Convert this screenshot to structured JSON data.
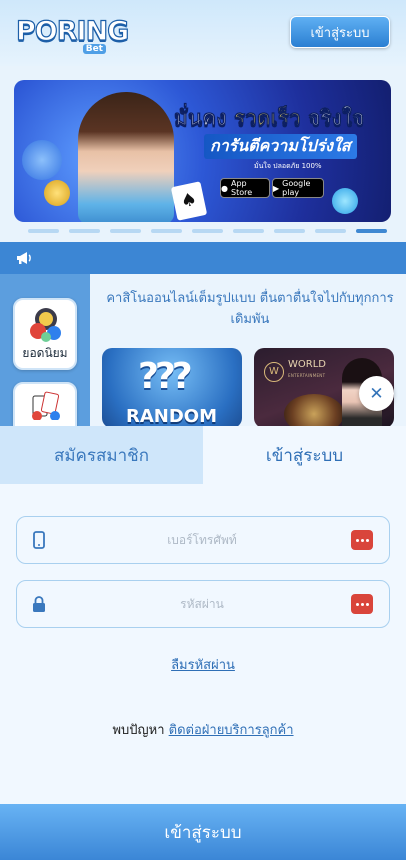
{
  "header": {
    "logo_text": "PORING",
    "logo_sub": "Bet",
    "login_button": "เข้าสู่ระบบ"
  },
  "banner": {
    "headline_part1": "มั่นคง",
    "headline_part2": "รวดเร็ว",
    "headline_part3": "จริงใจ",
    "subheadline": "การันตีความโปร่งใส",
    "small_text": "มั่นใจ ปลอดภัย 100%",
    "app_store": "App Store",
    "google_play": "Google play",
    "slides_total": 9,
    "active_slide": 9
  },
  "sidebar": {
    "items": [
      {
        "label": "ยอดนิยม"
      },
      {
        "label": ""
      }
    ]
  },
  "content": {
    "tagline": "คาสิโนออนไลน์เต็มรูปแบบ ตื่นตาตื่นใจไปกับทุกการเดิมพัน",
    "games": [
      {
        "title": "RANDOM"
      },
      {
        "title": "WORLD",
        "subtitle": "ENTERTAINMENT"
      }
    ]
  },
  "login_sheet": {
    "tabs": {
      "register": "สมัครสมาชิก",
      "login": "เข้าสู่ระบบ"
    },
    "phone": {
      "placeholder": "เบอร์โทรศัพท์",
      "value": ""
    },
    "password": {
      "placeholder": "รหัสผ่าน",
      "value": ""
    },
    "forgot_password": "ลืมรหัสผ่าน",
    "help_text": "พบปัญหา",
    "help_link": "ติดต่อฝ่ายบริการลูกค้า",
    "submit": "เข้าสู่ระบบ"
  },
  "colors": {
    "primary": "#3c86d4",
    "accent_red": "#d9453b",
    "text_blue": "#2f6fb6"
  }
}
